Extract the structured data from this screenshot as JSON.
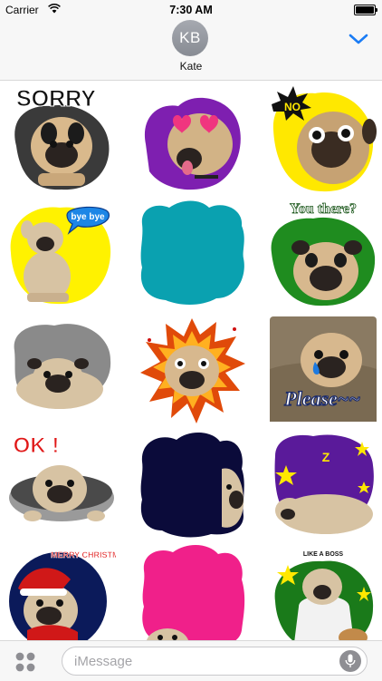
{
  "status_bar": {
    "carrier": "Carrier",
    "time": "7:30 AM",
    "wifi_icon": "wifi-icon",
    "battery_icon": "battery-full-icon"
  },
  "header": {
    "avatar_initials": "KB",
    "contact_name": "Kate",
    "collapse_icon": "chevron-down-icon",
    "accent_color": "#1a7cf5"
  },
  "stickers": [
    {
      "row": 1,
      "col": 1,
      "text": "SORRY",
      "blob_color": "#3a3a3a",
      "description": "sad pug"
    },
    {
      "row": 1,
      "col": 2,
      "text": "",
      "blob_color": "#7e1fb0",
      "description": "pug with heart eyes"
    },
    {
      "row": 1,
      "col": 3,
      "text": "NO",
      "blob_color": "#ffe800",
      "description": "pug shouting no"
    },
    {
      "row": 2,
      "col": 1,
      "text": "bye bye",
      "blob_color": "#fff200",
      "description": "pug waving bye"
    },
    {
      "row": 2,
      "col": 2,
      "text": "",
      "blob_color": "#0aa1b0",
      "description": "blank teal sticker"
    },
    {
      "row": 2,
      "col": 3,
      "text": "You there?",
      "blob_color": "#1f8c1f",
      "description": "pug peeking"
    },
    {
      "row": 3,
      "col": 1,
      "text": "",
      "blob_color": "#8a8a8a",
      "description": "pug lying down"
    },
    {
      "row": 3,
      "col": 2,
      "text": "",
      "blob_color": "#e04a0a",
      "description": "surprised pug burst"
    },
    {
      "row": 3,
      "col": 3,
      "text": "Please~~",
      "blob_color": "#8a7a62",
      "description": "crying pug on sofa"
    },
    {
      "row": 4,
      "col": 1,
      "text": "OK !",
      "blob_color": "#9a9a9a",
      "description": "pug in a hole"
    },
    {
      "row": 4,
      "col": 2,
      "text": "",
      "blob_color": "#0b0b3a",
      "description": "pug peeking from edge"
    },
    {
      "row": 4,
      "col": 3,
      "text": "Z",
      "blob_color": "#5a1a9a",
      "description": "sleeping pug at night"
    },
    {
      "row": 5,
      "col": 1,
      "text": "MERRY CHRISTMAS",
      "blob_color": "#0b1a5a",
      "description": "pug in santa hat"
    },
    {
      "row": 5,
      "col": 2,
      "text": "",
      "blob_color": "#f0208a",
      "description": "pug peeking from bottom"
    },
    {
      "row": 5,
      "col": 3,
      "text": "LIKE A BOSS",
      "blob_color": "#1a7a1a",
      "description": "pug in bathrobe"
    }
  ],
  "bottom_bar": {
    "apps_icon": "apps-grid-icon",
    "placeholder": "iMessage",
    "mic_icon": "microphone-icon"
  }
}
